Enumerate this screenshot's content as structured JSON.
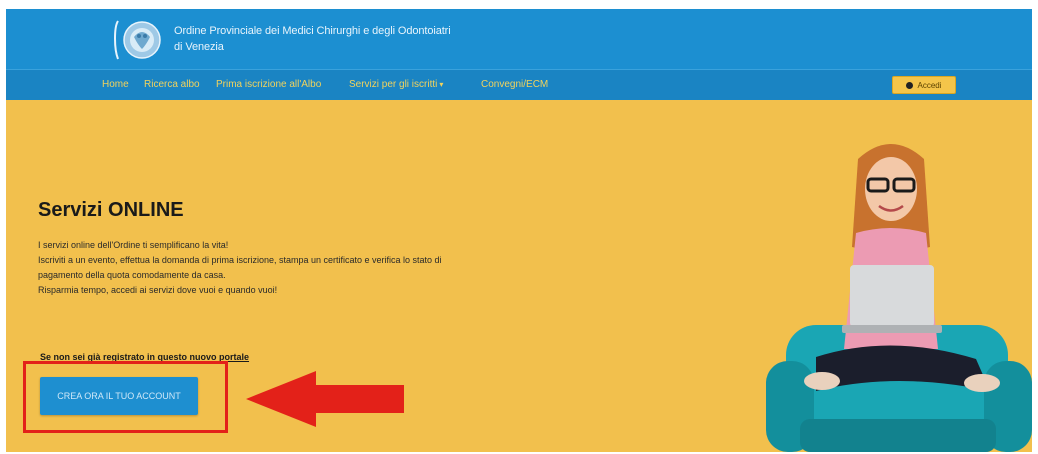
{
  "header": {
    "org_line1": "Ordine Provinciale dei Medici Chirurghi e degli Odontoiatri",
    "org_line2": "di Venezia",
    "logo_icon": "lion-of-st-mark-logo"
  },
  "nav": {
    "items": [
      {
        "label": "Home"
      },
      {
        "label": "Ricerca albo"
      },
      {
        "label": "Prima iscrizione all'Albo"
      },
      {
        "label": "Servizi per gli iscritti"
      },
      {
        "label": "Convegni/ECM"
      }
    ],
    "dropdown_icon": "▾",
    "login_label": "Accedi",
    "login_icon": "user-icon"
  },
  "hero": {
    "title": "Servizi ONLINE",
    "lines": [
      "I servizi online dell'Ordine ti semplificano la vita!",
      "Iscriviti a un evento, effettua la domanda di prima iscrizione, stampa un certificato e verifica lo stato di",
      "pagamento della quota comodamente da casa.",
      "Risparmia tempo, accedi ai servizi dove vuoi e quando vuoi!"
    ],
    "register_prompt": "Se non sei già registrato in questo nuovo portale",
    "cta_label": "Crea ora il tuo account"
  },
  "colors": {
    "header_blue": "#1c8fd1",
    "nav_blue": "#1a84c3",
    "nav_text": "#f2d35c",
    "hero_yellow": "#f2c04d",
    "cta_blue": "#1e8fd0",
    "annotation_red": "#e32119"
  },
  "annotations": {
    "highlight_box": "red-rectangle",
    "pointer": "red-arrow"
  }
}
